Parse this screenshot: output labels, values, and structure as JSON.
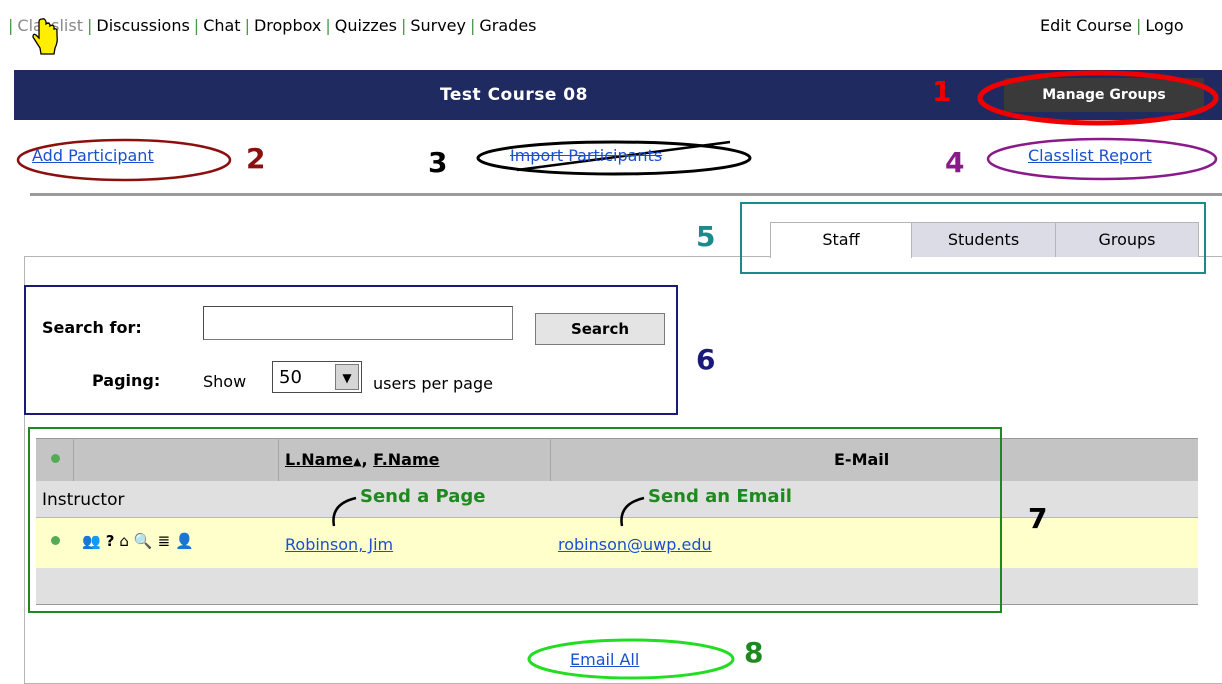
{
  "nav": {
    "items": [
      "Classlist",
      "Discussions",
      "Chat",
      "Dropbox",
      "Quizzes",
      "Survey",
      "Grades"
    ],
    "right": [
      "Edit Course",
      "Logo"
    ]
  },
  "course": {
    "title": "Test Course 08",
    "manage_groups": "Manage Groups"
  },
  "links": {
    "add_participant": "Add Participant",
    "import_participants": "Import Participants",
    "classlist_report": "Classlist Report"
  },
  "tabs": [
    "Staff",
    "Students",
    "Groups"
  ],
  "search": {
    "label": "Search for:",
    "button": "Search",
    "paging_label": "Paging:",
    "show": "Show",
    "per_page_value": "50",
    "suffix": "users per page"
  },
  "table": {
    "col_name": "L.Name",
    "col_sort_arrow": "▲",
    "col_comma": ",",
    "col_fname": "F.Name",
    "col_email": "E-Mail",
    "group": "Instructor",
    "rows": [
      {
        "name": "Robinson, Jim",
        "email": "robinson@uwp.edu"
      }
    ]
  },
  "annotations": {
    "send_page": "Send a Page",
    "send_email": "Send an Email",
    "numbers": [
      "1",
      "2",
      "3",
      "4",
      "5",
      "6",
      "7",
      "8"
    ]
  },
  "email_all": "Email All",
  "colors": {
    "header_bg": "#1f2a61",
    "link": "#1a4fd0",
    "red": "#ee0000",
    "darkred": "#8a1010",
    "purple": "#8a1a8a",
    "teal": "#1a8a8a",
    "navy": "#1a1a7a",
    "green": "#1e8a1e",
    "lime": "#22dd22"
  }
}
